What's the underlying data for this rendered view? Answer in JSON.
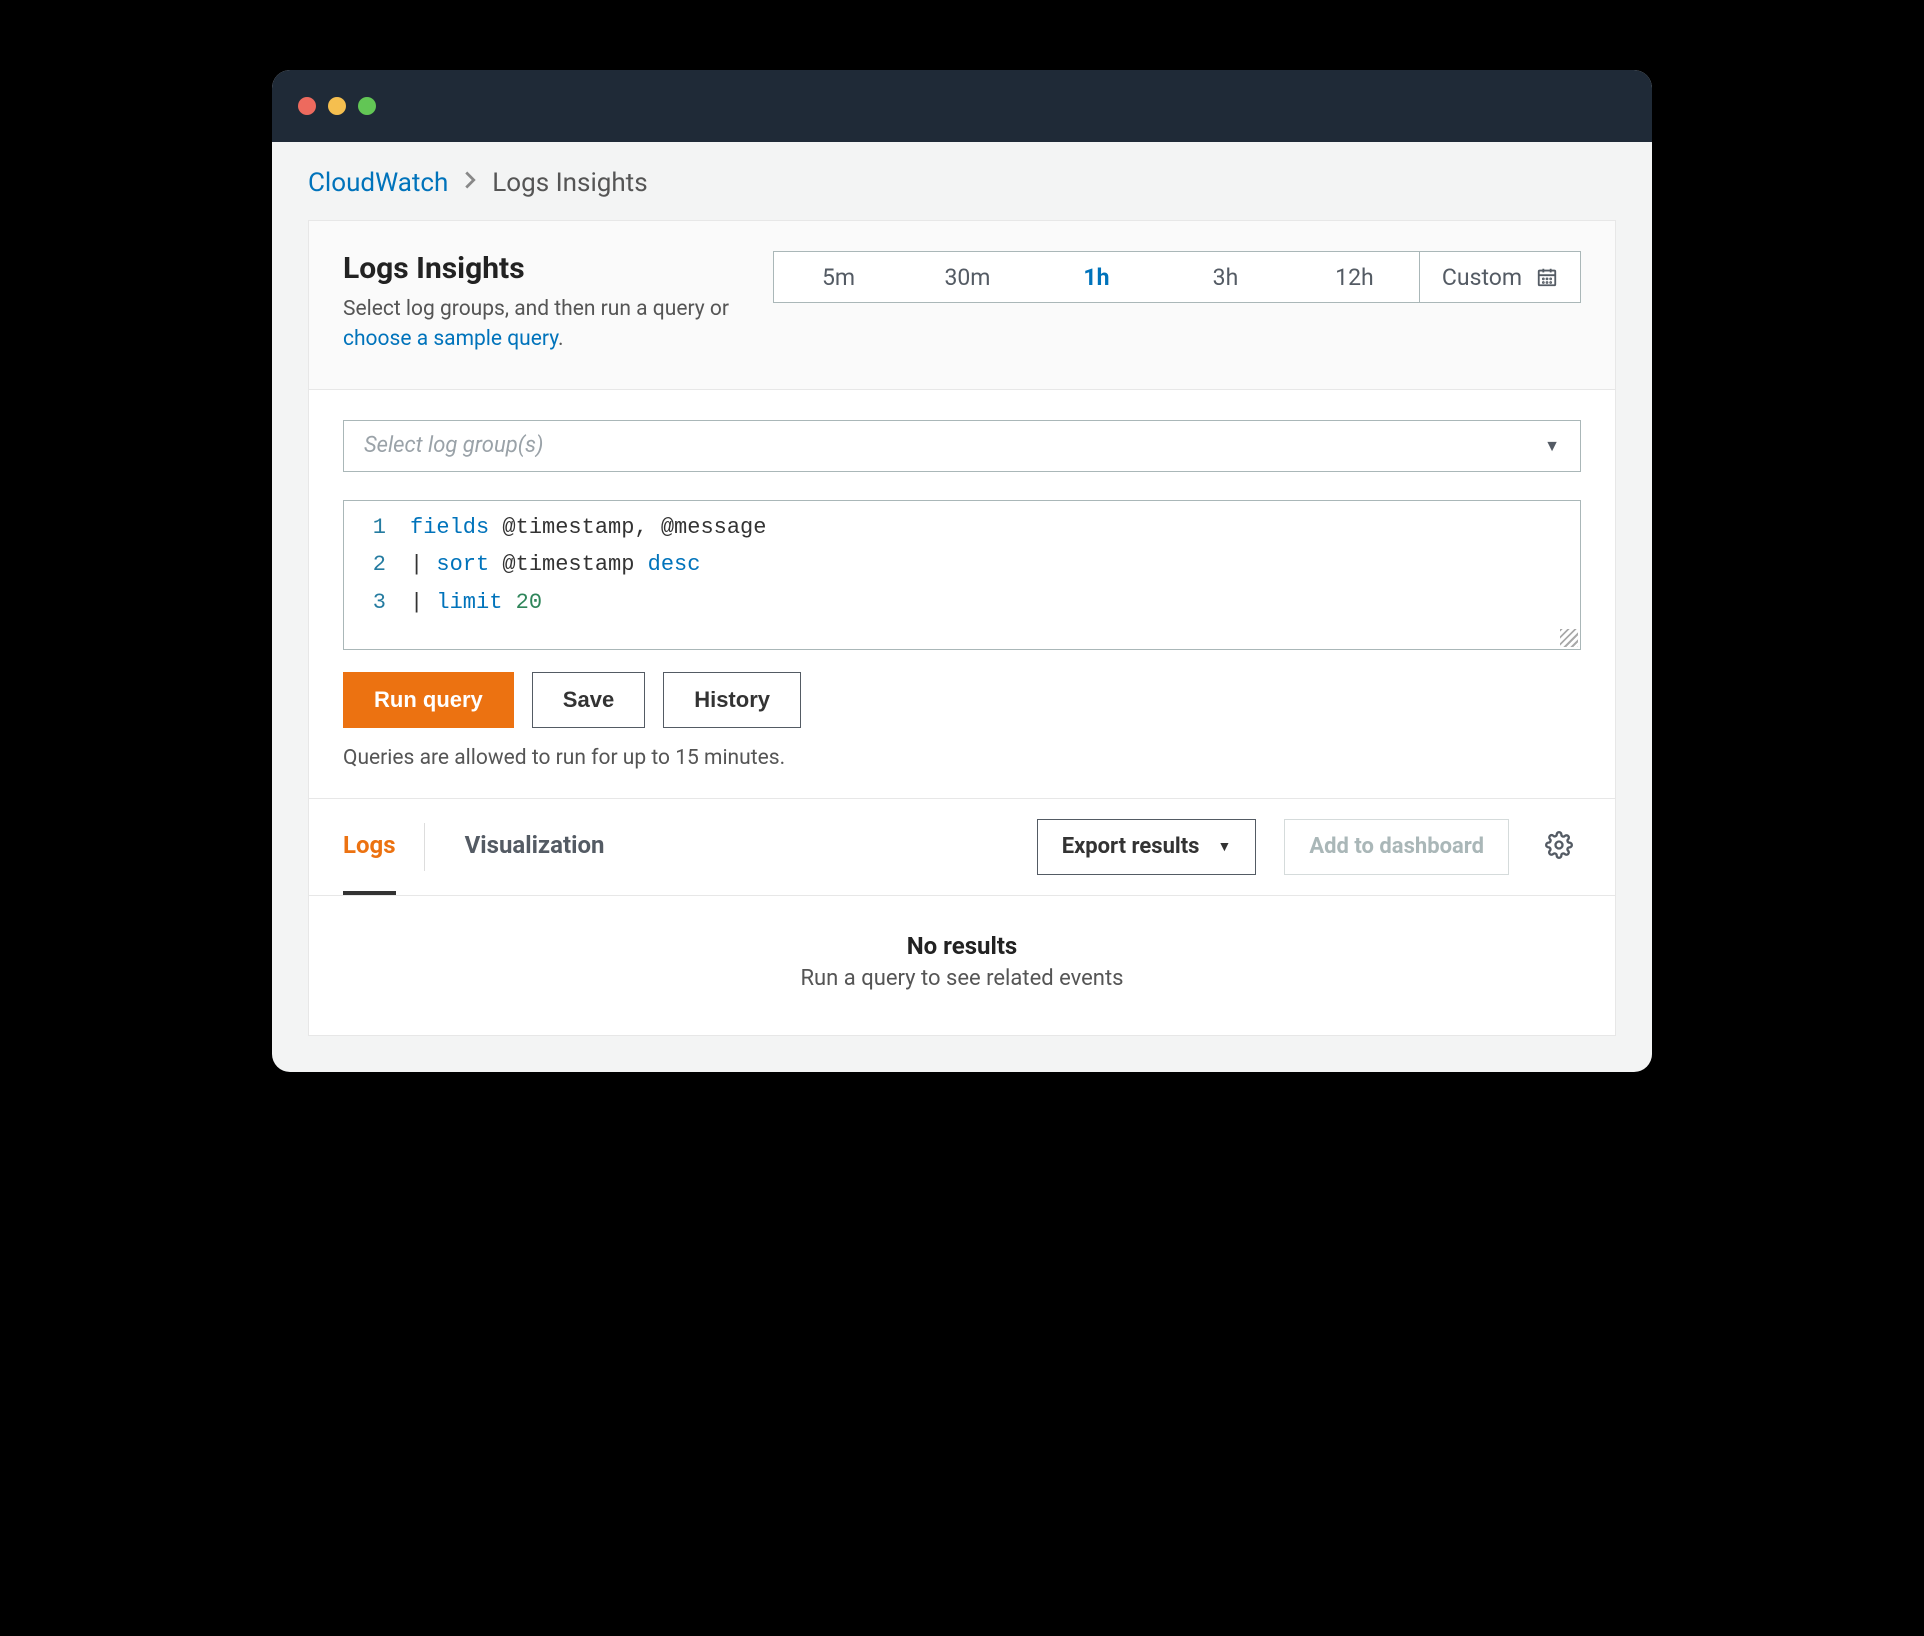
{
  "breadcrumb": {
    "root": "CloudWatch",
    "current": "Logs Insights"
  },
  "header": {
    "title": "Logs Insights",
    "subtitle_before": "Select log groups, and then run a query or ",
    "subtitle_link": "choose a sample query",
    "subtitle_after": "."
  },
  "time_picker": {
    "options": [
      "5m",
      "30m",
      "1h",
      "3h",
      "12h"
    ],
    "selected": "1h",
    "custom_label": "Custom"
  },
  "select": {
    "placeholder": "Select log group(s)"
  },
  "editor": {
    "lines": [
      {
        "n": "1",
        "tokens": [
          {
            "t": "fields",
            "c": "kw-blue"
          },
          {
            "t": " @timestamp, @message"
          }
        ]
      },
      {
        "n": "2",
        "tokens": [
          {
            "t": "| "
          },
          {
            "t": "sort",
            "c": "kw-blue"
          },
          {
            "t": " @timestamp "
          },
          {
            "t": "desc",
            "c": "kw-blue"
          }
        ]
      },
      {
        "n": "3",
        "tokens": [
          {
            "t": "| "
          },
          {
            "t": "limit",
            "c": "kw-blue"
          },
          {
            "t": " "
          },
          {
            "t": "20",
            "c": "kw-green"
          }
        ]
      }
    ]
  },
  "buttons": {
    "run": "Run query",
    "save": "Save",
    "history": "History"
  },
  "hint": "Queries are allowed to run for up to 15 minutes.",
  "tabs": {
    "logs": "Logs",
    "viz": "Visualization"
  },
  "actions": {
    "export": "Export results",
    "add_dash": "Add to dashboard"
  },
  "results": {
    "title": "No results",
    "subtitle": "Run a query to see related events"
  }
}
